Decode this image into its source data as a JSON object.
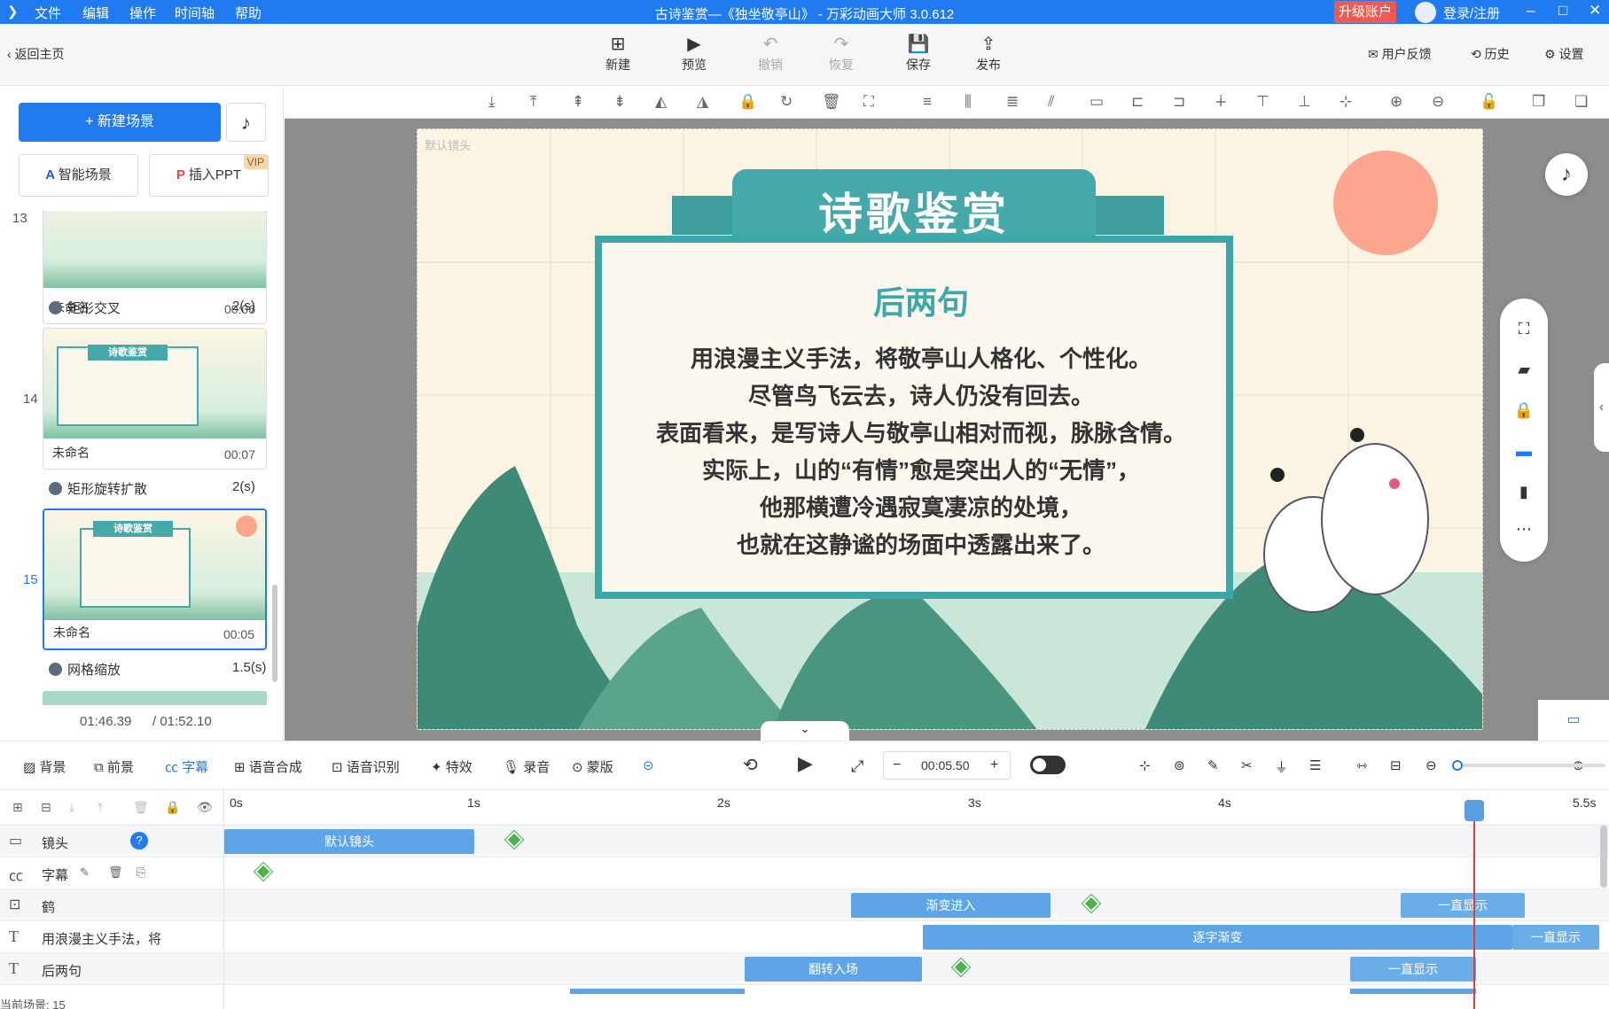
{
  "window": {
    "title": "古诗鉴赏—《独坐敬亭山》 - 万彩动画大师 3.0.612",
    "menu": [
      "文件",
      "编辑",
      "操作",
      "时间轴",
      "帮助"
    ],
    "upgrade": "升级账户",
    "login": "登录/注册"
  },
  "toolbar": {
    "back": "返回主页",
    "buttons": [
      "新建",
      "预览",
      "撤销",
      "恢复",
      "保存",
      "发布"
    ],
    "feedback": "用户反馈",
    "history": "历史",
    "settings": "设置"
  },
  "left": {
    "new_scene": "新建场景",
    "smart_scene": "智能场景",
    "insert_ppt": "插入PPT",
    "vip": "VIP",
    "scenes": [
      {
        "num": "13",
        "name": "未命名",
        "time": "00:06",
        "transition": "矩形交叉",
        "dur": "2(s)"
      },
      {
        "num": "14",
        "name": "未命名",
        "time": "00:07",
        "transition": "矩形旋转扩散",
        "dur": "2(s)"
      },
      {
        "num": "15",
        "name": "未命名",
        "time": "00:05",
        "transition": "网格缩放",
        "dur": "1.5(s)"
      }
    ],
    "time_current": "01:46.39",
    "time_total": "/ 01:52.10"
  },
  "canvas": {
    "camera_label": "默认镜头",
    "title": "诗歌鉴赏",
    "subtitle": "后两句",
    "lines": [
      "用浪漫主义手法，将敬亭山人格化、个性化。",
      "尽管鸟飞云去，诗人仍没有回去。",
      "表面看来，是写诗人与敬亭山相对而视，脉脉含情。",
      "实际上，山的“有情”愈是突出人的“无情”，",
      "他那横遭冷遇寂寞凄凉的处境，",
      "也就在这静谧的场面中透露出来了。"
    ],
    "thumb_title": "诗歌鉴赏",
    "thumb_sub": "后两句"
  },
  "bottom": {
    "tools": [
      "背景",
      "前景",
      "字幕",
      "语音合成",
      "语音识别",
      "特效",
      "录音",
      "蒙版"
    ],
    "time": "00:05.50"
  },
  "timeline": {
    "ticks": [
      "0s",
      "1s",
      "2s",
      "3s",
      "4s",
      "5.5s"
    ],
    "tracks": [
      {
        "name": "镜头"
      },
      {
        "name": "字幕"
      },
      {
        "name": "鹤"
      },
      {
        "name": "用浪漫主义手法，将"
      },
      {
        "name": "后两句"
      }
    ],
    "clips": {
      "cam": "默认镜头",
      "he1": "渐变进入",
      "he2": "一直显示",
      "txt1": "逐字渐变",
      "txt2": "一直显示",
      "hl1": "翻转入场",
      "hl2": "一直显示"
    },
    "current_scene": "当前场景: 15"
  },
  "colors": {
    "accent": "#1f7bef",
    "teal": "#3aa8a8",
    "sun": "#fca690"
  }
}
